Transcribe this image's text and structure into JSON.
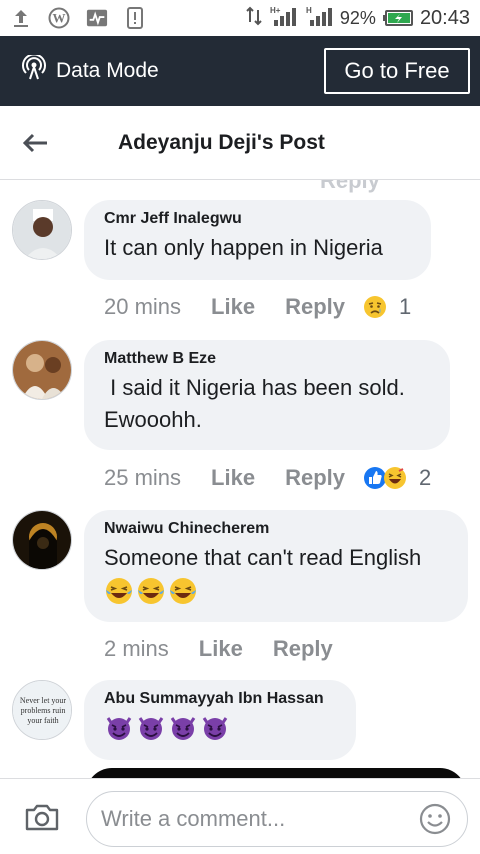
{
  "status_bar": {
    "network": "H+",
    "battery": "92%",
    "time": "20:43"
  },
  "data_bar": {
    "mode_label": "Data Mode",
    "go_free_label": "Go to Free"
  },
  "post": {
    "title": "Adeyanju Deji's Post"
  },
  "comments": [
    {
      "author": "Cmr Jeff Inalegwu",
      "text": "It can only happen in Nigeria",
      "time": "20 mins",
      "like": "Like",
      "reply": "Reply",
      "reactions": [
        "sad"
      ],
      "reaction_count": "1"
    },
    {
      "author": "Matthew B Eze",
      "text": " I said it Nigeria has been sold.\nEwooohh.",
      "time": "25 mins",
      "like": "Like",
      "reply": "Reply",
      "reactions": [
        "like",
        "haha"
      ],
      "reaction_count": "2"
    },
    {
      "author": "Nwaiwu Chinecherem",
      "text": "Someone that can't read English",
      "emojis": [
        "tears-of-joy",
        "tears-of-joy",
        "tears-of-joy"
      ],
      "time": "2 mins",
      "like": "Like",
      "reply": "Reply"
    },
    {
      "author": "Abu Summayyah Ibn Hassan",
      "emojis": [
        "devil",
        "devil",
        "devil",
        "devil"
      ],
      "avatar_text": "Never let your problems ruin your faith"
    }
  ],
  "composer": {
    "placeholder": "Write a comment..."
  },
  "colors": {
    "data_bar_bg": "#232b36",
    "bubble_bg": "#f0f2f5",
    "meta_text": "#8a8d91",
    "like_blue": "#1877f2",
    "emoji_yellow": "#f7c52f",
    "devil_purple": "#7a3fa8"
  }
}
